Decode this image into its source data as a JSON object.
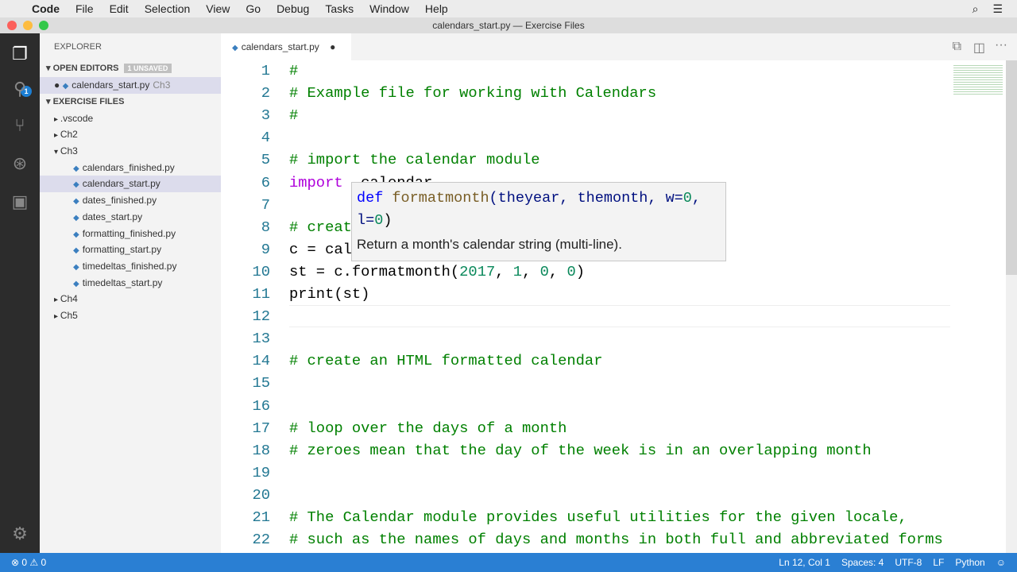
{
  "menubar": {
    "app": "Code",
    "items": [
      "File",
      "Edit",
      "Selection",
      "View",
      "Go",
      "Debug",
      "Tasks",
      "Window",
      "Help"
    ]
  },
  "window_title": "calendars_start.py — Exercise Files",
  "activity": {
    "badge": "1"
  },
  "sidebar": {
    "title": "EXPLORER",
    "open_editors": "OPEN EDITORS",
    "unsaved": "1 UNSAVED",
    "open_file": "calendars_start.py",
    "open_file_dir": "Ch3",
    "exercise": "EXERCISE FILES",
    "tree": [
      {
        "label": ".vscode",
        "type": "folder",
        "open": false,
        "depth": 1
      },
      {
        "label": "Ch2",
        "type": "folder",
        "open": false,
        "depth": 1
      },
      {
        "label": "Ch3",
        "type": "folder",
        "open": true,
        "depth": 1
      },
      {
        "label": "calendars_finished.py",
        "type": "file",
        "depth": 2
      },
      {
        "label": "calendars_start.py",
        "type": "file",
        "depth": 2,
        "selected": true
      },
      {
        "label": "dates_finished.py",
        "type": "file",
        "depth": 2
      },
      {
        "label": "dates_start.py",
        "type": "file",
        "depth": 2
      },
      {
        "label": "formatting_finished.py",
        "type": "file",
        "depth": 2
      },
      {
        "label": "formatting_start.py",
        "type": "file",
        "depth": 2
      },
      {
        "label": "timedeltas_finished.py",
        "type": "file",
        "depth": 2
      },
      {
        "label": "timedeltas_start.py",
        "type": "file",
        "depth": 2
      },
      {
        "label": "Ch4",
        "type": "folder",
        "open": false,
        "depth": 1
      },
      {
        "label": "Ch5",
        "type": "folder",
        "open": false,
        "depth": 1
      }
    ]
  },
  "tab": {
    "label": "calendars_start.py"
  },
  "code": [
    [
      [
        "cm",
        "#"
      ]
    ],
    [
      [
        "cm",
        "# Example file for working with Calendars"
      ]
    ],
    [
      [
        "cm",
        "#"
      ]
    ],
    [],
    [
      [
        "cm",
        "# import the calendar module"
      ]
    ],
    [
      [
        "kw",
        "import"
      ],
      [
        "",
        "  calendar"
      ]
    ],
    [],
    [
      [
        "cm",
        "# creat"
      ]
    ],
    [
      [
        "",
        "c = cal"
      ]
    ],
    [
      [
        "",
        "st = c.formatmonth("
      ],
      [
        "nu",
        "2017"
      ],
      [
        "",
        ", "
      ],
      [
        "nu",
        "1"
      ],
      [
        "",
        ", "
      ],
      [
        "nu",
        "0"
      ],
      [
        "",
        ", "
      ],
      [
        "nu",
        "0"
      ],
      [
        "",
        ")"
      ]
    ],
    [
      [
        "",
        "print(st)"
      ]
    ],
    [],
    [],
    [
      [
        "cm",
        "# create an HTML formatted calendar"
      ]
    ],
    [],
    [],
    [
      [
        "cm",
        "# loop over the days of a month"
      ]
    ],
    [
      [
        "cm",
        "# zeroes mean that the day of the week is in an overlapping month"
      ]
    ],
    [],
    [],
    [
      [
        "cm",
        "# The Calendar module provides useful utilities for the given locale,"
      ]
    ],
    [
      [
        "cm",
        "# such as the names of days and months in both full and abbreviated forms"
      ]
    ]
  ],
  "hover": {
    "sig_def": "def",
    "sig_name": "formatmonth",
    "sig_params1": "(theyear, themonth, w=",
    "sig_n1": "0",
    "sig_params2": ",\nl=",
    "sig_n2": "0",
    "sig_end": ")",
    "doc": "Return a month's calendar string (multi-line)."
  },
  "status": {
    "errors": "0",
    "warnings": "0",
    "position": "Ln 12, Col 1",
    "spaces": "Spaces: 4",
    "encoding": "UTF-8",
    "eol": "LF",
    "language": "Python"
  }
}
